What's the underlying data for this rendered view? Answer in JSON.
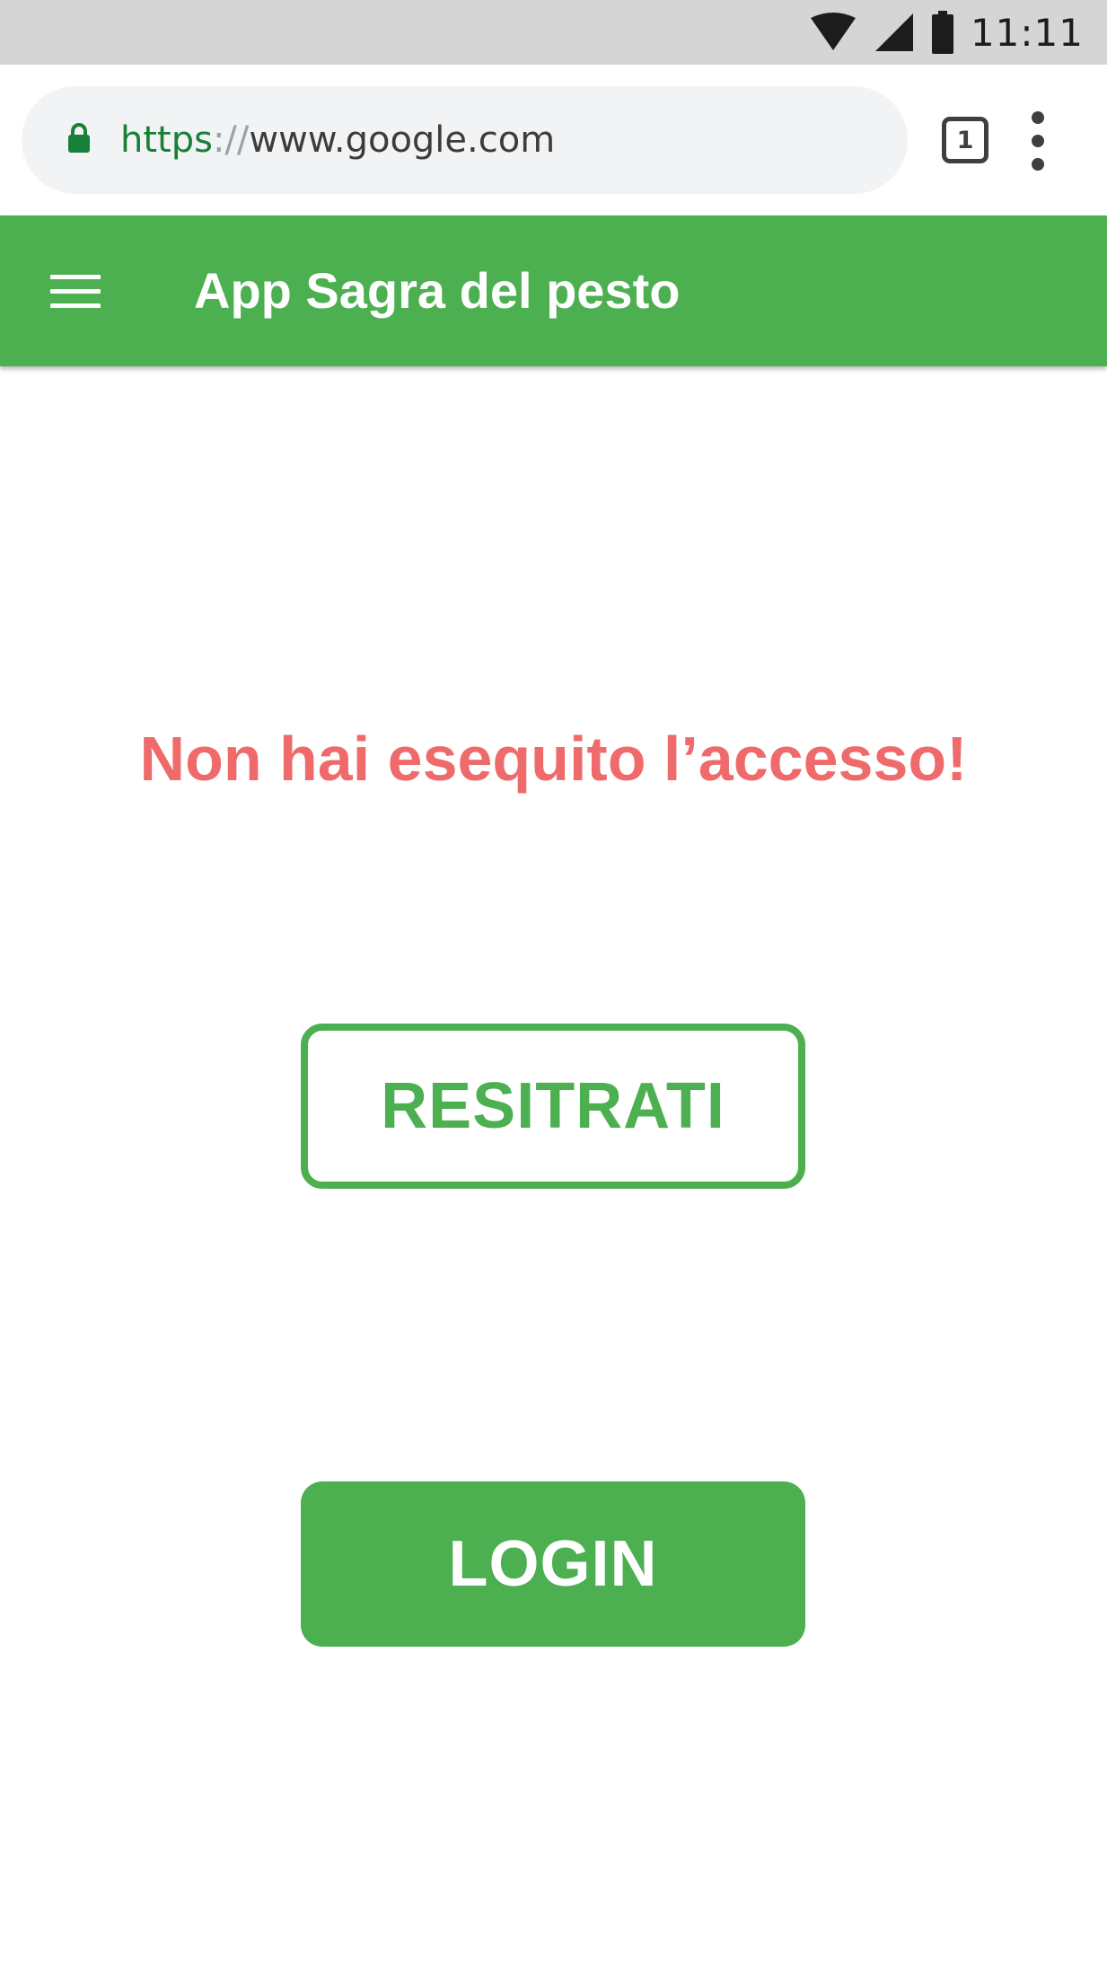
{
  "status_bar": {
    "time": "11:11",
    "icons": [
      "wifi-icon",
      "cellular-signal-icon",
      "battery-icon"
    ]
  },
  "browser": {
    "url_scheme": "https",
    "url_separator": "://",
    "url_host": "www.google.com",
    "tab_count": "1",
    "icons": [
      "lock-icon",
      "tab-switcher-icon",
      "overflow-menu-icon"
    ]
  },
  "app_bar": {
    "title": "App Sagra del pesto",
    "icon": "hamburger-menu-icon"
  },
  "main": {
    "message": "Non hai esequito l’accesso!",
    "register_label": "RESITRATI",
    "login_label": "LOGIN"
  },
  "colors": {
    "primary_green": "#4caf50",
    "warning_red": "#ef6b6b",
    "status_bar_gray": "#d5d5d5",
    "url_green": "#188038"
  }
}
